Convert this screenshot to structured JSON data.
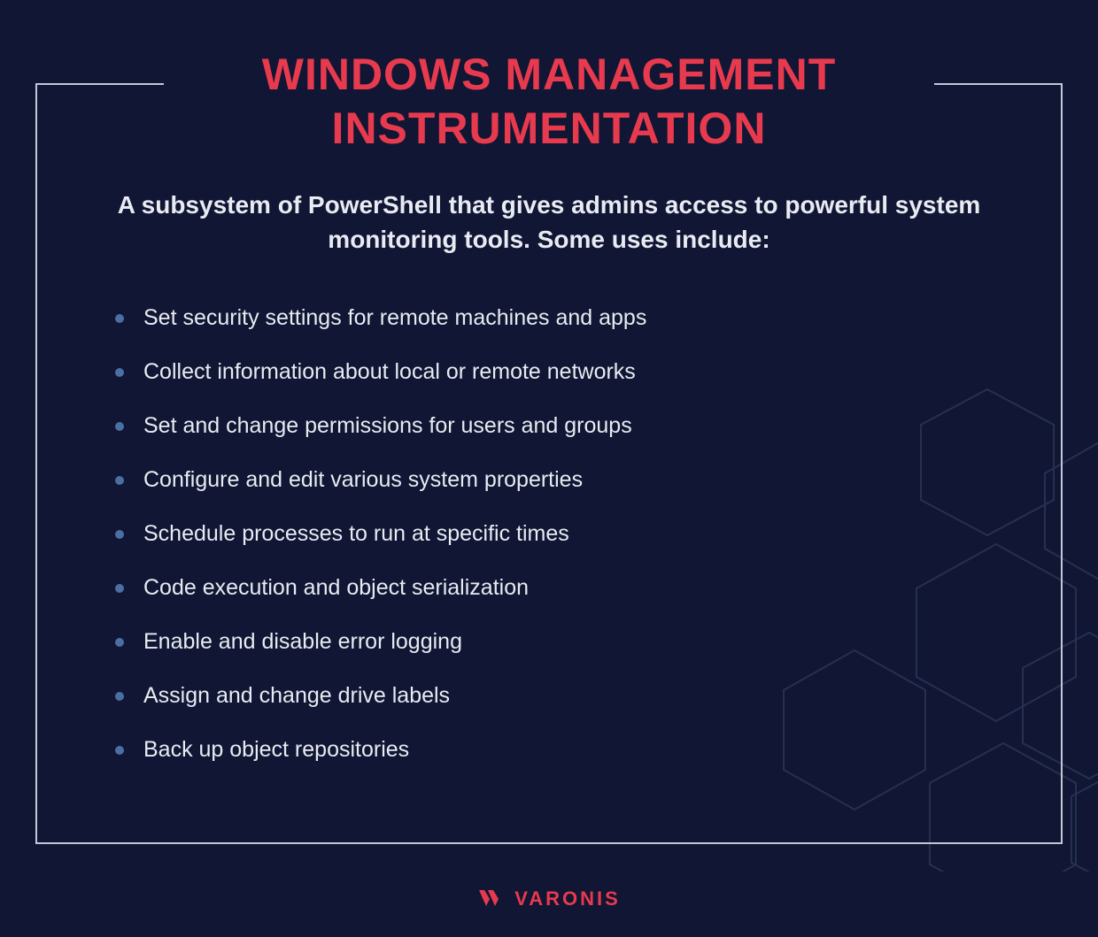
{
  "title_line1": "WINDOWS MANAGEMENT",
  "title_line2": "INSTRUMENTATION",
  "description": "A subsystem of PowerShell that gives admins access to powerful system monitoring tools. Some uses include:",
  "items": [
    "Set security settings for remote machines and apps",
    "Collect information about local or remote networks",
    "Set and change permissions for users and groups",
    "Configure and edit various system properties",
    "Schedule processes to run at specific times",
    "Code execution and object serialization",
    "Enable and disable error logging",
    "Assign and change drive labels",
    "Back up object repositories"
  ],
  "brand": "VARONIS"
}
